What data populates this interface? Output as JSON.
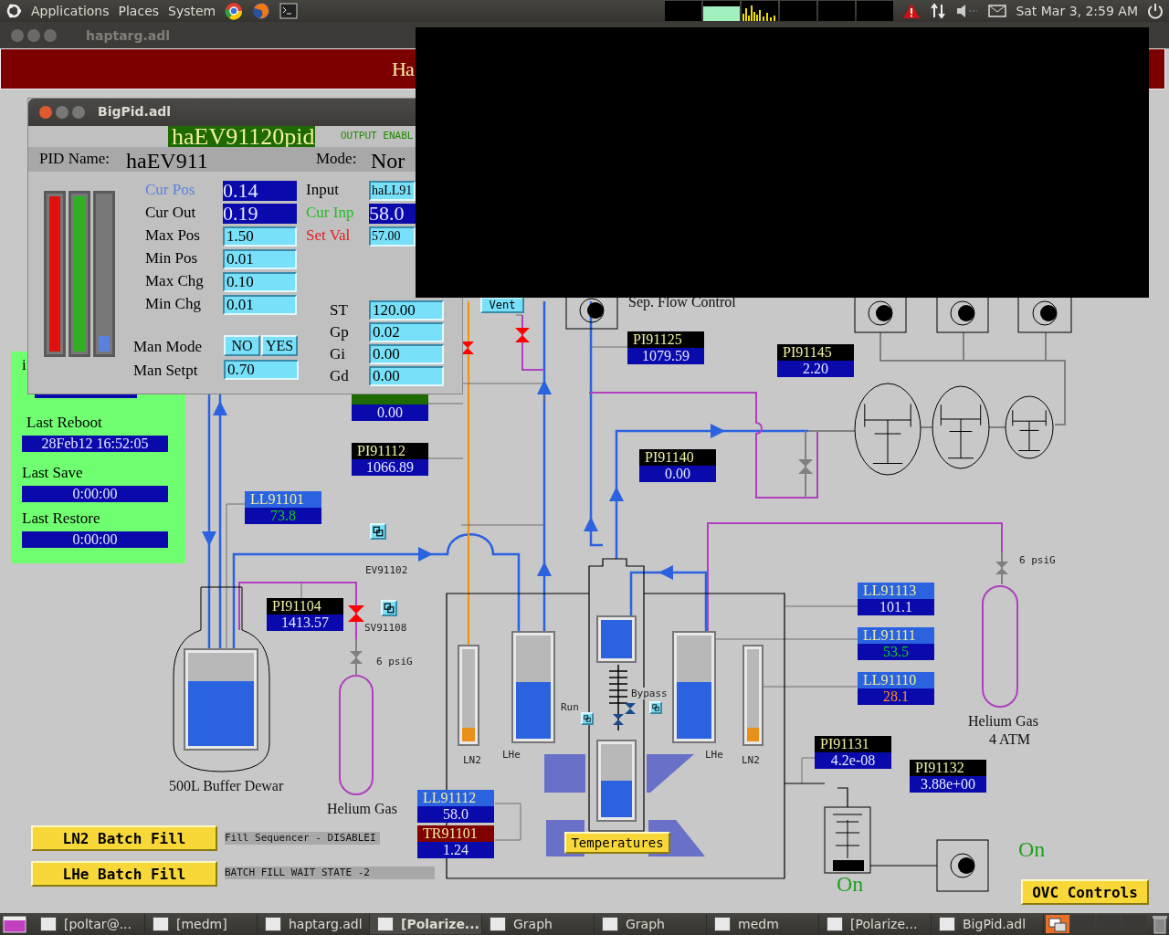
{
  "top_panel": {
    "menus": [
      "Applications",
      "Places",
      "System"
    ],
    "clock": "Sat Mar 3, 2:59 AM"
  },
  "main_window": {
    "title": "haptarg.adl",
    "banner": "Ha"
  },
  "bigpid": {
    "title": "BigPid.adl",
    "record": "haEV91120pid",
    "output": "OUTPUT ENABL",
    "pid_name_label": "PID Name:",
    "pid_name": "haEV911",
    "mode_label": "Mode:",
    "mode": "Nor",
    "bars": [
      {
        "color": "#e01010",
        "level": 1
      },
      {
        "color": "#30b020",
        "level": 1
      },
      {
        "color": "#5a80e0",
        "level": 0.1
      }
    ],
    "left_rows": [
      {
        "label": "Cur Pos",
        "color": "#5a80e0",
        "kind": "monitor",
        "value": "0.14"
      },
      {
        "label": "Cur Out",
        "color": "#000000",
        "kind": "monitor",
        "value": "0.19"
      },
      {
        "label": "Max Pos",
        "color": "#000000",
        "kind": "entry",
        "value": "1.50"
      },
      {
        "label": "Min Pos",
        "color": "#000000",
        "kind": "entry",
        "value": "0.01"
      },
      {
        "label": "Max Chg",
        "color": "#000000",
        "kind": "entry",
        "value": "0.10"
      },
      {
        "label": "Min Chg",
        "color": "#000000",
        "kind": "entry",
        "value": "0.01"
      }
    ],
    "right_rows": [
      {
        "label": "Input",
        "color": "#000000",
        "kind": "entry",
        "value": "haLL91"
      },
      {
        "label": "Cur Inp",
        "color": "#20c020",
        "kind": "monitor",
        "value": "58.0"
      },
      {
        "label": "Set Val",
        "color": "#e02020",
        "kind": "entry",
        "value": "57.00"
      }
    ],
    "gain_rows": [
      {
        "label": "ST",
        "color": "#000000",
        "kind": "entry",
        "value": "120.00"
      },
      {
        "label": "Gp",
        "color": "#000000",
        "kind": "entry",
        "value": "0.02"
      },
      {
        "label": "Gi",
        "color": "#000000",
        "kind": "entry",
        "value": "0.00"
      },
      {
        "label": "Gd",
        "color": "#000000",
        "kind": "entry",
        "value": "0.00"
      }
    ],
    "man_mode": {
      "label": "Man Mode",
      "options": [
        "NO",
        "YES"
      ]
    },
    "man_setpt": {
      "label": "Man Setpt",
      "value": "0.70"
    }
  },
  "status_panel": {
    "cut_label": "i",
    "items": [
      {
        "label": "Last Reboot",
        "value": "28Feb12 16:52:05"
      },
      {
        "label": "Last Save",
        "value": "0:00:00"
      },
      {
        "label": "Last Restore",
        "value": "0:00:00"
      }
    ]
  },
  "readouts": [
    {
      "color": "#1e6a00",
      "reading": {
        "value": "0.00",
        "kind": "normal"
      }
    },
    {
      "tag": "PI91112",
      "color": "#000000",
      "reading": {
        "value": "1066.89",
        "kind": "normal"
      }
    },
    {
      "tag": "LL91101",
      "color": "#2a62e0",
      "reading": {
        "value": "73.8",
        "kind": "ok"
      }
    },
    {
      "tag": "PI91104",
      "color": "#000000",
      "reading": {
        "value": "1413.57",
        "kind": "normal"
      }
    },
    {
      "tag": "PI91125",
      "color": "#000000",
      "reading": {
        "value": "1079.59",
        "kind": "normal"
      }
    },
    {
      "tag": "PI91145",
      "color": "#000000",
      "reading": {
        "value": "2.20",
        "kind": "normal"
      }
    },
    {
      "tag": "PI91140",
      "color": "#000000",
      "reading": {
        "value": "0.00",
        "kind": "normal"
      }
    },
    {
      "tag": "LL91113",
      "color": "#2a62e0",
      "reading": {
        "value": "101.1",
        "kind": "normal"
      }
    },
    {
      "tag": "LL91111",
      "color": "#2a62e0",
      "reading": {
        "value": "53.5",
        "kind": "ok"
      }
    },
    {
      "tag": "LL91110",
      "color": "#2a62e0",
      "reading": {
        "value": "28.1",
        "kind": "warning"
      }
    },
    {
      "tag": "LL91112",
      "color": "#2a62e0",
      "reading": {
        "value": "58.0",
        "kind": "normal"
      }
    },
    {
      "tag": "TR91101",
      "color": "#800000",
      "reading": {
        "value": "1.24",
        "kind": "normal"
      }
    },
    {
      "tag": "PI91131",
      "color": "#000000",
      "reading": {
        "value": "4.2e-08",
        "kind": "normal"
      }
    },
    {
      "tag": "PI91132",
      "color": "#000000",
      "reading": {
        "value": "3.88e+00",
        "kind": "normal"
      }
    }
  ],
  "vessels": [
    {
      "kind": "ln2",
      "level": 0.15
    },
    {
      "kind": "lhe",
      "level": 0.55
    },
    {
      "kind": "lhe",
      "level": 1
    },
    {
      "kind": "lhe",
      "level": 0.5
    },
    {
      "kind": "lhe",
      "level": 0.55
    },
    {
      "kind": "ln2",
      "level": 0.15
    },
    {
      "kind": "lhe",
      "level": 0.7
    }
  ],
  "labels": [
    {
      "text": "Sep. Flow Control",
      "kind": "caption"
    },
    {
      "text": "EV91102",
      "kind": "tag"
    },
    {
      "text": "SV91108",
      "kind": "tag"
    },
    {
      "text": "6 psiG",
      "kind": "tag"
    },
    {
      "text": "500L Buffer Dewar",
      "kind": "caption"
    },
    {
      "text": "Helium Gas",
      "kind": "caption"
    },
    {
      "text": "LN2",
      "kind": "tag"
    },
    {
      "text": "LHe",
      "kind": "tag"
    },
    {
      "text": "Run",
      "kind": "tag"
    },
    {
      "text": "Bypass",
      "kind": "tag"
    },
    {
      "text": "LHe",
      "kind": "tag"
    },
    {
      "text": "LN2",
      "kind": "tag"
    },
    {
      "text": "6 psiG",
      "kind": "tag"
    },
    {
      "text": "Helium Gas",
      "kind": "caption"
    },
    {
      "text": "4 ATM",
      "kind": "caption"
    }
  ],
  "buttons": [
    {
      "label": "Vent",
      "kind": "vent"
    },
    {
      "label": "Temperatures",
      "kind": "related"
    },
    {
      "label": "LN2 Batch Fill",
      "kind": "related"
    },
    {
      "label": "LHe Batch Fill",
      "kind": "related"
    },
    {
      "label": "OVC Controls",
      "kind": "related"
    }
  ],
  "states": [
    "On",
    "On"
  ],
  "fill_status": [
    "Fill Sequencer - DISABLEI",
    "BATCH FILL WAIT STATE -2"
  ],
  "taskbar": {
    "items": [
      {
        "label": "[poltar@...",
        "selected": false
      },
      {
        "label": "[medm]",
        "selected": false
      },
      {
        "label": "haptarg.adl",
        "selected": false
      },
      {
        "label": "[Polarize...",
        "selected": true
      },
      {
        "label": "Graph",
        "selected": false
      },
      {
        "label": "Graph",
        "selected": false
      },
      {
        "label": "medm",
        "selected": false
      },
      {
        "label": "[Polarize...",
        "selected": false
      },
      {
        "label": "BigPid.adl",
        "selected": false
      }
    ]
  }
}
